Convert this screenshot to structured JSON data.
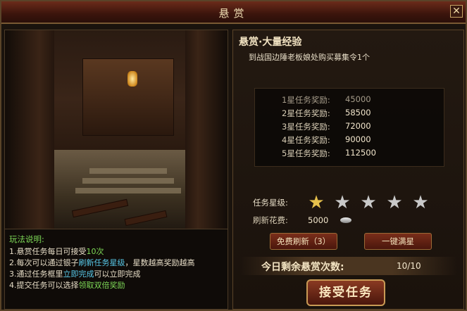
{
  "window": {
    "title": "悬赏",
    "close_label": "✕"
  },
  "rules": {
    "title": "玩法说明:",
    "lines": [
      {
        "prefix": "1.悬赏任务每日可接受",
        "highlight": "10次",
        "suffix": ""
      },
      {
        "prefix": "2.每次可以通过银子",
        "highlight": "刷新任务星级",
        "suffix": "，星数越高奖励越高"
      },
      {
        "prefix": "3.通过任务框里",
        "highlight": "立即完成",
        "suffix": "可以立即完成"
      },
      {
        "prefix": "4.提交任务可以选择",
        "highlight": "领取双倍奖励",
        "suffix": ""
      }
    ]
  },
  "mission": {
    "title": "悬赏·大量经验",
    "description": "到战国边陲老板娘处购买募集令1个"
  },
  "rewards": [
    {
      "label": "1星任务奖励:",
      "value": "45000"
    },
    {
      "label": "2星任务奖励:",
      "value": "58500"
    },
    {
      "label": "3星任务奖励:",
      "value": "72000"
    },
    {
      "label": "4星任务奖励:",
      "value": "90000"
    },
    {
      "label": "5星任务奖励:",
      "value": "112500"
    }
  ],
  "stars": {
    "label": "任务星级:",
    "current": 1,
    "max": 5
  },
  "refresh_cost": {
    "label": "刷新花费:",
    "value": "5000",
    "icon": "silver-ingot-icon"
  },
  "buttons": {
    "free_refresh": "免费刷新（3）",
    "max_star": "一键满星",
    "accept": "接受任务"
  },
  "remaining": {
    "label": "今日剩余悬赏次数:",
    "value": "10/10"
  },
  "colors": {
    "highlight_green": "#7ed957",
    "highlight_cyan": "#58c8e8",
    "star_gold": "#e6c04c"
  }
}
